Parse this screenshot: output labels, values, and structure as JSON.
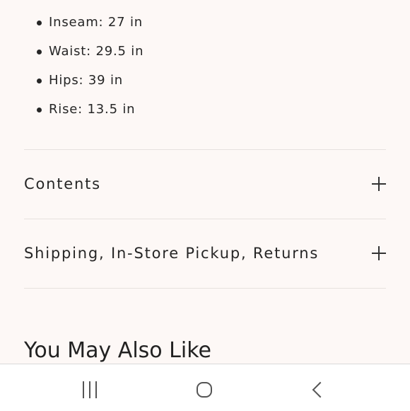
{
  "specs": [
    "Inseam: 27 in",
    "Waist: 29.5 in",
    "Hips: 39 in",
    "Rise: 13.5 in"
  ],
  "accordions": {
    "contents_label": "Contents",
    "shipping_label": "Shipping, In-Store Pickup, Returns"
  },
  "recommendations": {
    "title": "You May Also Like"
  },
  "icons": {
    "expand": "plus-icon",
    "recents": "recents-icon",
    "home": "home-icon",
    "back": "back-icon"
  },
  "colors": {
    "page_background": "#fdf8f6",
    "text": "#262626",
    "divider": "#e6e1de",
    "navbar_background": "#ffffff",
    "nav_icon": "#555555"
  }
}
